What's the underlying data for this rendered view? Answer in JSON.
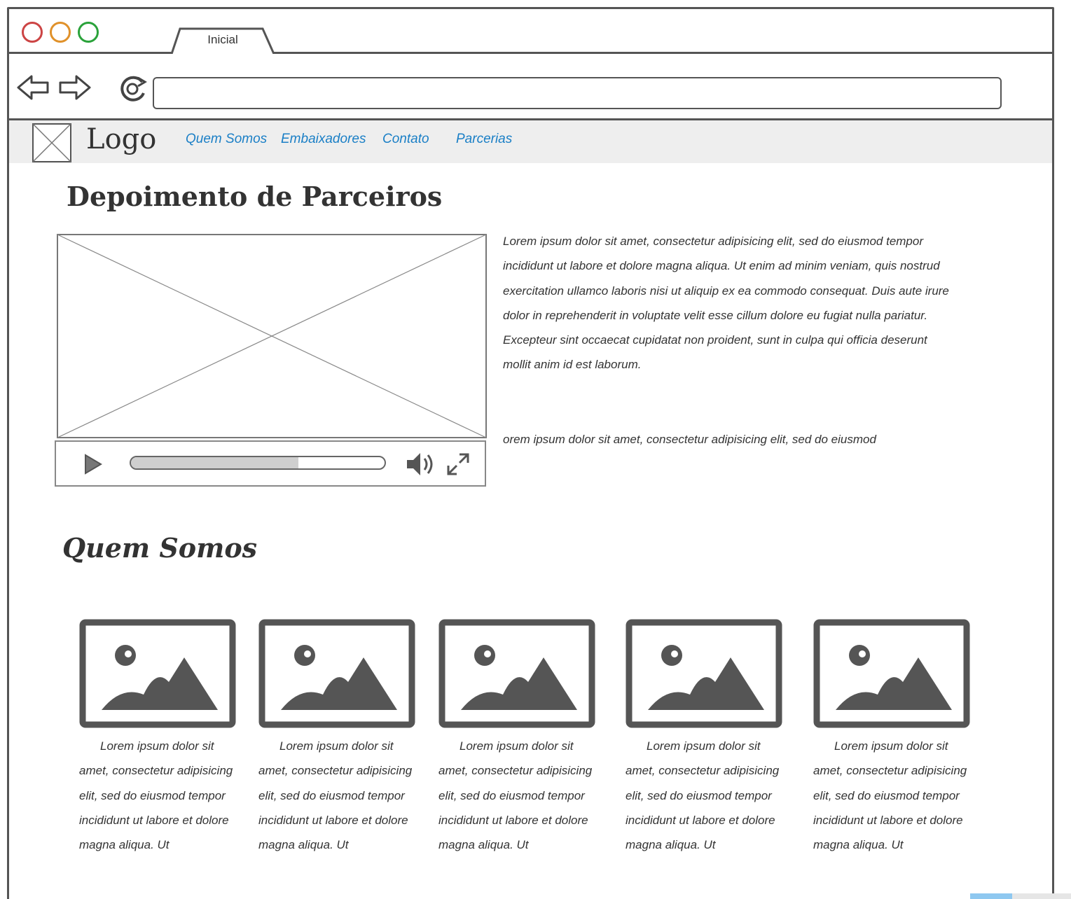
{
  "browser": {
    "tab_label": "Inicial",
    "address_value": ""
  },
  "header": {
    "logo_text": "Logo",
    "menu": [
      "Quem Somos",
      "Embaixadores",
      "Contato",
      "Parcerias"
    ]
  },
  "testimonials": {
    "title": "Depoimento de Parceiros",
    "paragraph_1": "Lorem ipsum dolor sit amet, consectetur adipisicing elit, sed do eiusmod tempor incididunt ut labore et dolore magna aliqua. Ut enim ad minim veniam, quis nostrud exercitation ullamco laboris nisi ut aliquip ex ea commodo consequat. Duis aute irure dolor in reprehenderit in voluptate velit esse cillum dolore eu fugiat nulla pariatur. Excepteur sint occaecat cupidatat non proident, sunt in culpa qui officia deserunt mollit anim id est laborum.",
    "paragraph_2": "orem ipsum dolor sit amet, consectetur adipisicing elit, sed do eiusmod",
    "video_progress_percent": 66
  },
  "about": {
    "title": "Quem Somos",
    "cards": [
      "Lorem ipsum dolor sit amet, consectetur adipisicing elit, sed do eiusmod tempor incididunt ut labore et dolore magna aliqua. Ut",
      "Lorem ipsum dolor sit amet, consectetur adipisicing elit, sed do eiusmod tempor incididunt ut labore et dolore magna aliqua. Ut",
      "Lorem ipsum dolor sit amet, consectetur adipisicing elit, sed do eiusmod tempor incididunt ut labore et dolore magna aliqua. Ut",
      "Lorem ipsum dolor sit amet, consectetur adipisicing elit, sed do eiusmod tempor incididunt ut labore et dolore magna aliqua. Ut",
      "Lorem ipsum dolor sit amet, consectetur adipisicing elit, sed do eiusmod tempor incididunt ut labore et dolore magna aliqua. Ut"
    ]
  },
  "colors": {
    "link": "#1a7fc6",
    "close_dot": "#cc4444",
    "minimize_dot": "#e0912a",
    "maximize_dot": "#2aa23a"
  },
  "icons": [
    "back-arrow-icon",
    "forward-arrow-icon",
    "reload-icon",
    "image-placeholder-icon",
    "play-icon",
    "volume-icon",
    "fullscreen-icon"
  ]
}
